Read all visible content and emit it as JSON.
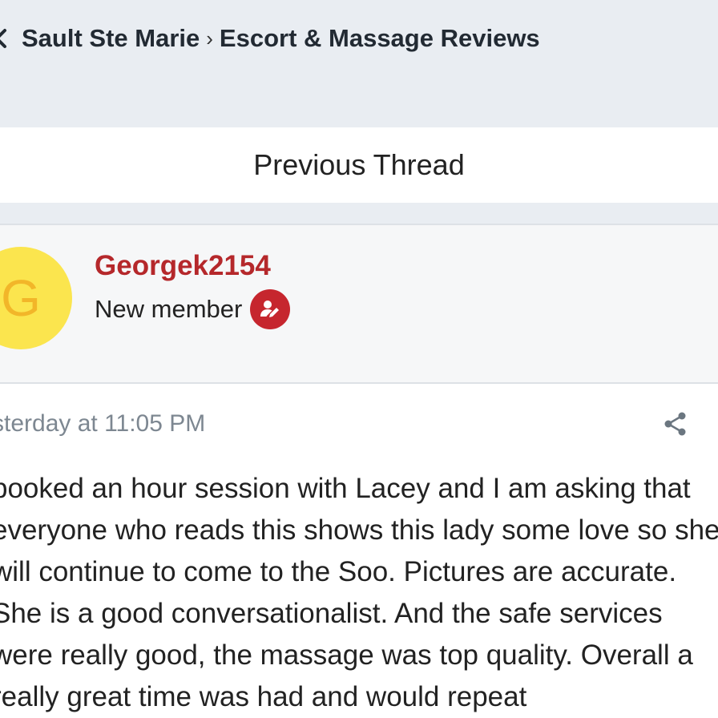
{
  "header": {
    "breadcrumb_parent": "Sault Ste Marie",
    "breadcrumb_separator": "›",
    "breadcrumb_current": "Escort & Massage Reviews",
    "back_icon": "chevron-left-icon"
  },
  "nav": {
    "previous_thread_label": "Previous Thread"
  },
  "author": {
    "avatar_letter": "G",
    "avatar_color": "#fbe54e",
    "avatar_letter_color": "#f2b629",
    "username": "Georgek2154",
    "username_color": "#b5282b",
    "role": "New member",
    "badge_icon": "user-edit-icon",
    "badge_color": "#c6262e"
  },
  "post": {
    "timestamp": "sterday at 11:05 PM",
    "share_icon": "share-icon",
    "lines": [
      "booked an hour session with Lacey and I am asking that",
      "everyone who reads this shows this lady some love so she",
      "will continue to come to the Soo. Pictures are accurate.",
      "She is a good conversationalist. And the safe services",
      "were really good, the massage was top quality. Overall a",
      "really great time was had and would repeat"
    ]
  }
}
